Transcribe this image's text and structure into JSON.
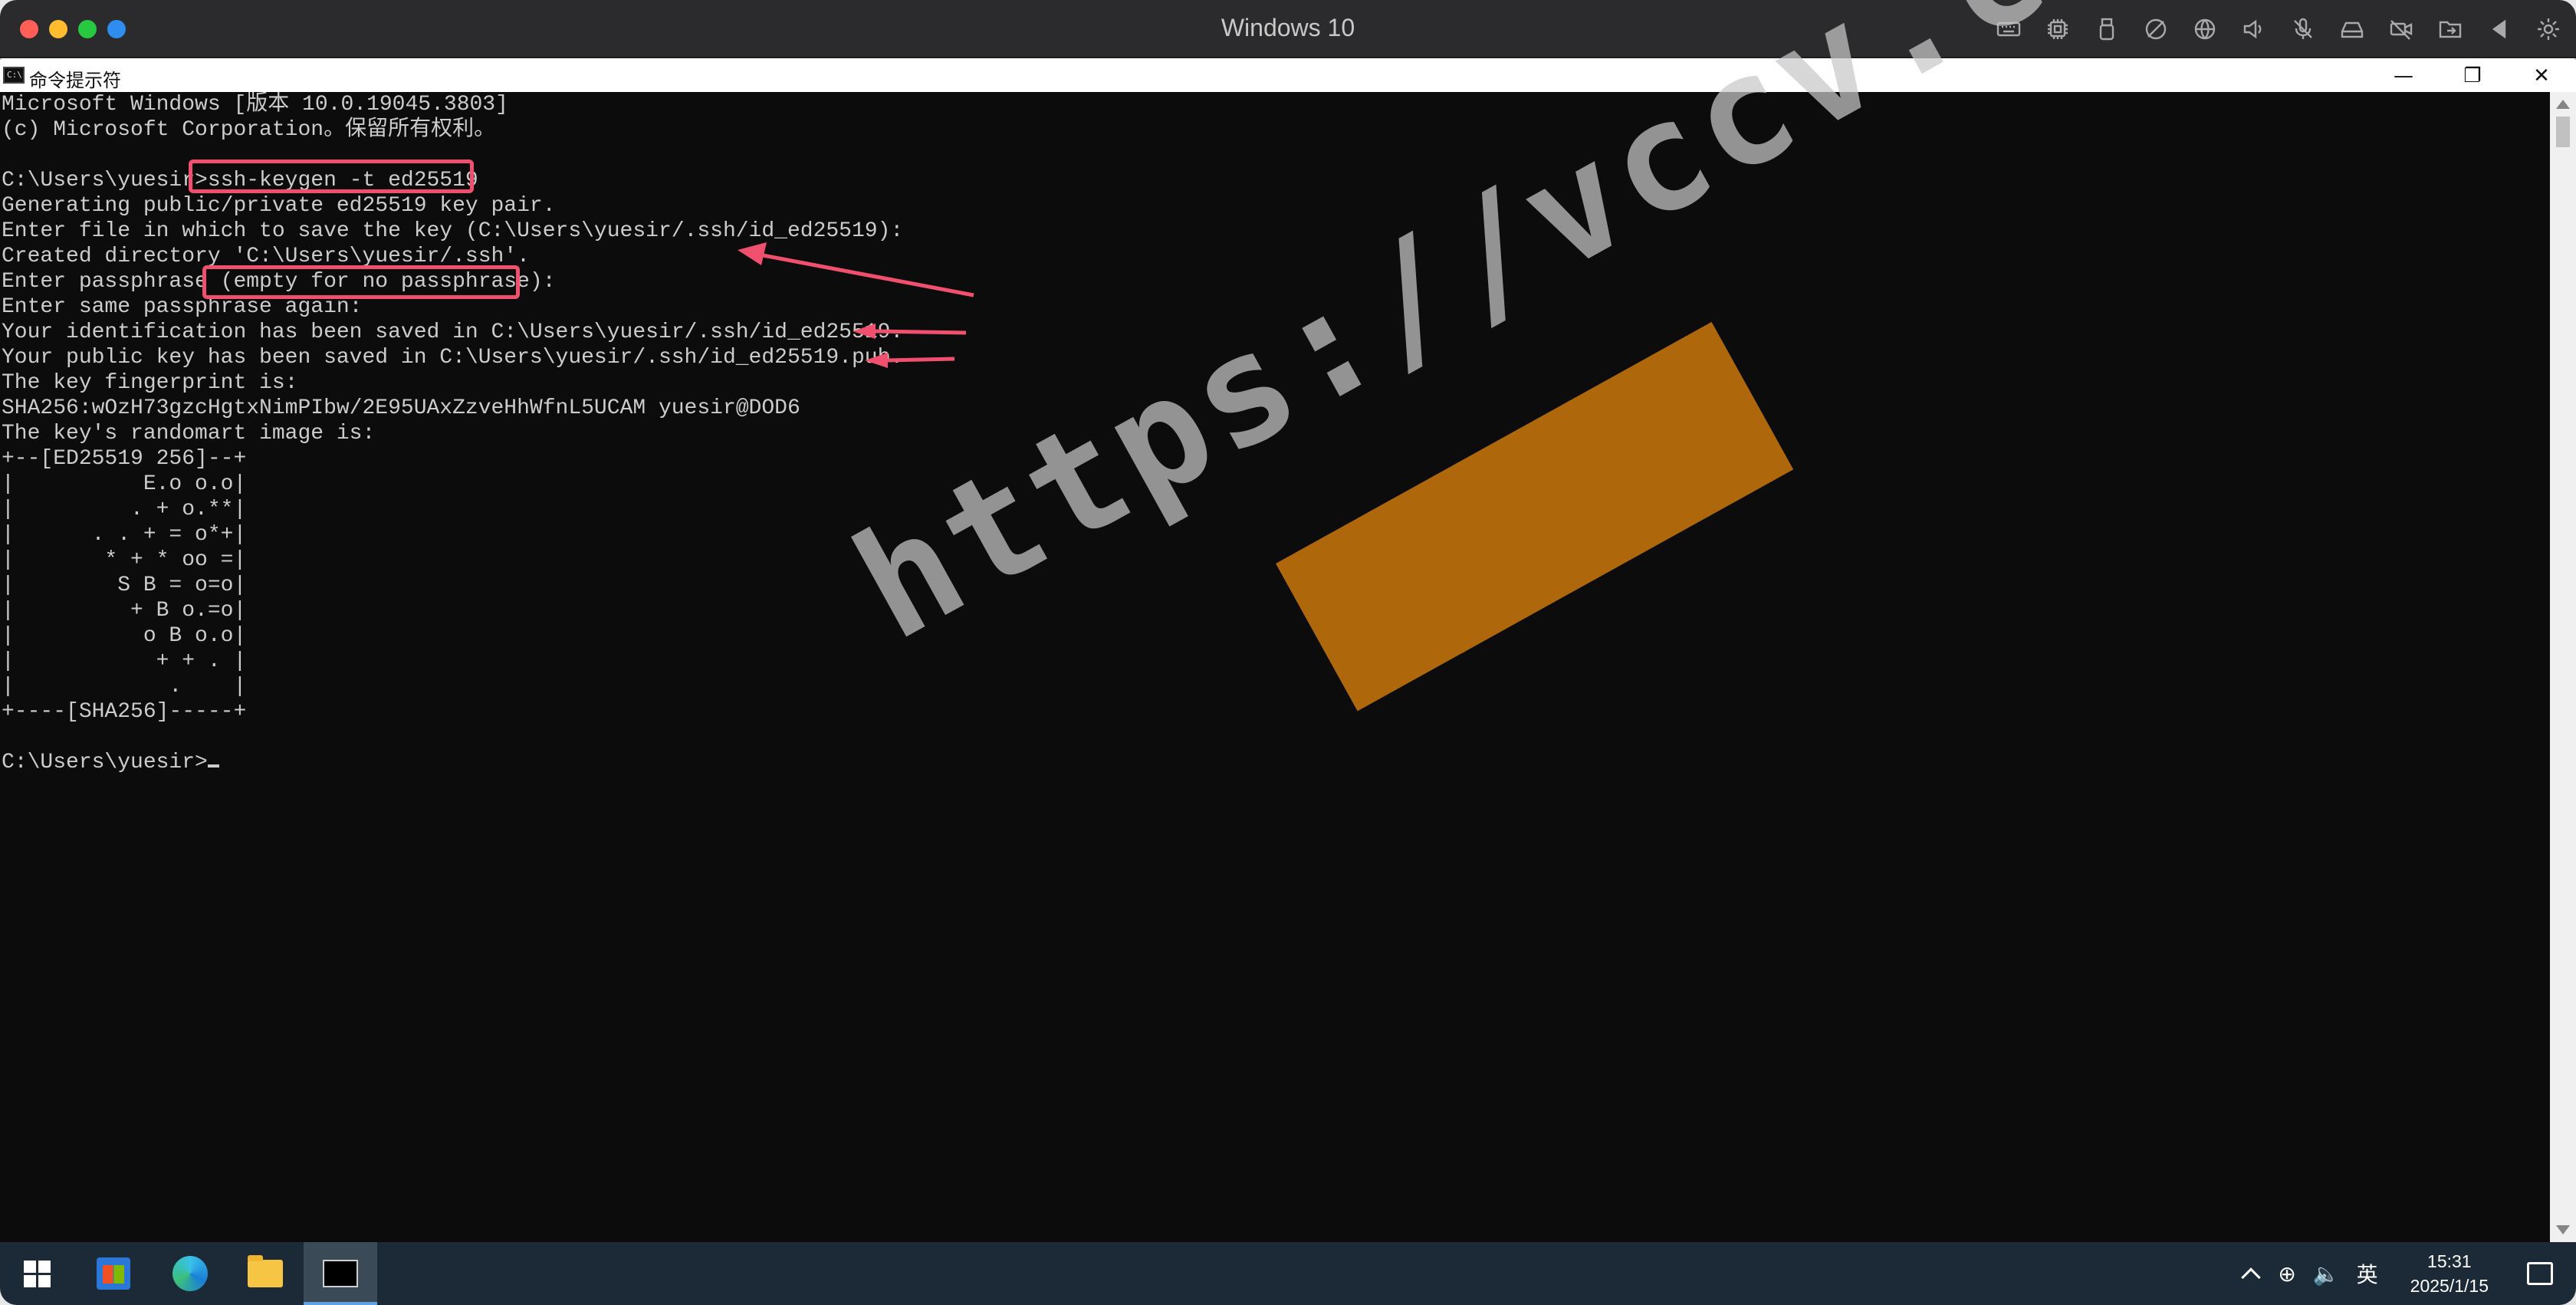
{
  "vm": {
    "title": "Windows 10",
    "toolbar_icons": [
      "keyboard-icon",
      "cpu-icon",
      "usb-icon",
      "no-camera-icon",
      "network-icon",
      "speaker-icon",
      "microphone-icon",
      "disk-icon",
      "video-off-icon",
      "shared-folder-icon",
      "back-icon",
      "settings-icon"
    ]
  },
  "cmd": {
    "title": "命令提示符",
    "min_glyph": "—",
    "max_glyph": "❐",
    "close_glyph": "✕",
    "lines": [
      "Microsoft Windows [版本 10.0.19045.3803]",
      "(c) Microsoft Corporation。保留所有权利。",
      "",
      "C:\\Users\\yuesir>ssh-keygen -t ed25519",
      "Generating public/private ed25519 key pair.",
      "Enter file in which to save the key (C:\\Users\\yuesir/.ssh/id_ed25519):",
      "Created directory 'C:\\Users\\yuesir/.ssh'.",
      "Enter passphrase (empty for no passphrase):",
      "Enter same passphrase again:",
      "Your identification has been saved in C:\\Users\\yuesir/.ssh/id_ed25519.",
      "Your public key has been saved in C:\\Users\\yuesir/.ssh/id_ed25519.pub.",
      "The key fingerprint is:",
      "SHA256:wOzH73gzcHgtxNimPIbw/2E95UAxZzveHhWfnL5UCAM yuesir@DOD6",
      "The key's randomart image is:",
      "+--[ED25519 256]--+",
      "|          E.o o.o|",
      "|         . + o.**|",
      "|      . . + = o*+|",
      "|       * + * oo =|",
      "|        S B = o=o|",
      "|         + B o.=o|",
      "|          o B o.o|",
      "|           + + . |",
      "|            .    |",
      "+----[SHA256]-----+",
      "",
      "C:\\Users\\yuesir>"
    ]
  },
  "watermark": "https://vccv.cc",
  "taskbar": {
    "apps": [
      "start-button",
      "store-app",
      "edge-app",
      "file-explorer-app",
      "cmd-app"
    ],
    "network_glyph": "⊕",
    "volume_glyph": "🔈",
    "ime": "英",
    "time": "15:31",
    "date": "2025/1/15"
  },
  "colors": {
    "annotation": "#f0506e",
    "console_bg": "#0c0c0c",
    "console_fg": "#cccccc",
    "taskbar_bg": "#1b2a36"
  }
}
